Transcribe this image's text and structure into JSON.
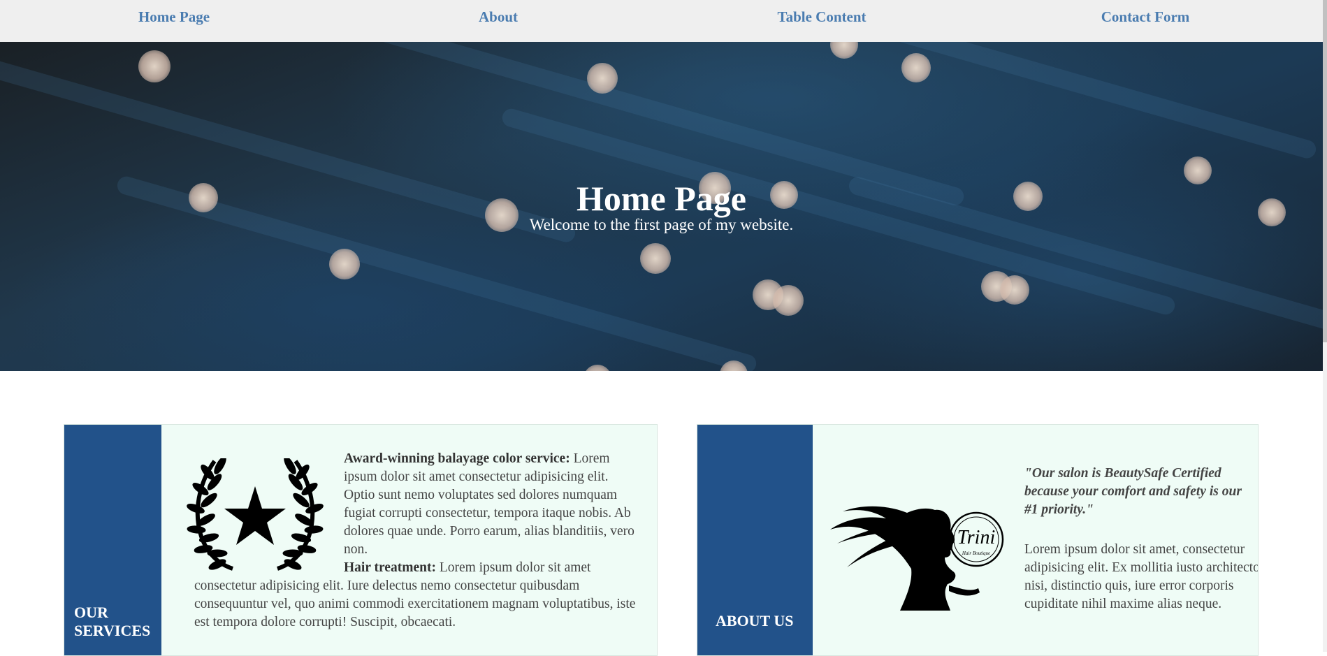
{
  "nav": {
    "items": [
      {
        "label": "Home Page"
      },
      {
        "label": "About"
      },
      {
        "label": "Table Content"
      },
      {
        "label": "Contact Form"
      }
    ],
    "color": "#4a7cb0",
    "background": "#efefef"
  },
  "hero": {
    "title": "Home Page",
    "subtitle": "Welcome to the first page of my website."
  },
  "services": {
    "label_line1": "OUR",
    "label_line2": "SERVICES",
    "icon": "laurel-star-icon",
    "item1_title": "Award-winning balayage color service:",
    "item1_text": " Lorem ipsum dolor sit amet consectetur adipisicing elit. Optio sunt nemo voluptates sed dolores numquam fugiat corrupti consectetur, tempora itaque nobis. Ab dolores quae unde. Porro earum, alias blanditiis, vero non.",
    "item2_title": "Hair treatment:",
    "item2_text": " Lorem ipsum dolor sit amet consectetur adipisicing elit. Iure delectus nemo consectetur quibusdam consequuntur vel, quo animi commodi exercitationem magnam voluptatibus, iste est tempora dolore corrupti! Suscipit, obcaecati."
  },
  "about": {
    "label": "ABOUT US",
    "image": "salon-logo-silhouette",
    "logo_script": "Trini",
    "logo_small": "Hair Boutique",
    "quote": "\"Our salon is BeautySafe Certified because your comfort and safety is our #1 priority.\"",
    "text": "Lorem ipsum dolor sit amet, consectetur adipisicing elit. Ex mollitia iusto architecto nisi, distinctio quis, iure error corporis cupiditate nihil maxime alias neque."
  },
  "colors": {
    "accent_bar": "#22528a",
    "card_background": "#effcf6"
  }
}
